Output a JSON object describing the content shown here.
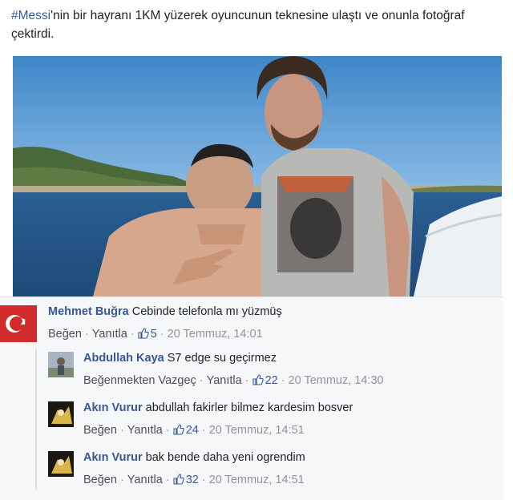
{
  "post": {
    "hashtag": "#Messi",
    "text_rest": "'nin bir hayranı 1KM yüzerek oyuncunun teknesine ulaştı ve onunla fotoğraf çektirdi."
  },
  "photo": {
    "description_icon": "photo-image"
  },
  "comments": [
    {
      "author": "Mehmet Buğra",
      "text": "Cebinde telefonla mı yüzmüş",
      "action": "Beğen",
      "reply": "Yanıtla",
      "likes": "5",
      "time": "20 Temmuz, 14:01"
    },
    {
      "author": "Abdullah Kaya",
      "text": "S7 edge su geçirmez",
      "action": "Beğenmekten Vazgeç",
      "reply": "Yanıtla",
      "likes": "22",
      "time": "20 Temmuz, 14:30"
    },
    {
      "author": "Akın Vurur",
      "text": "abdullah fakirler bilmez kardesim bosver",
      "action": "Beğen",
      "reply": "Yanıtla",
      "likes": "24",
      "time": "20 Temmuz, 14:51"
    },
    {
      "author": "Akın Vurur",
      "text": "bak bende daha yeni ogrendim",
      "action": "Beğen",
      "reply": "Yanıtla",
      "likes": "32",
      "time": "20 Temmuz, 14:51"
    }
  ],
  "colors": {
    "link": "#365899",
    "meta": "#90949c",
    "comment_bg": "#f6f7f9"
  }
}
